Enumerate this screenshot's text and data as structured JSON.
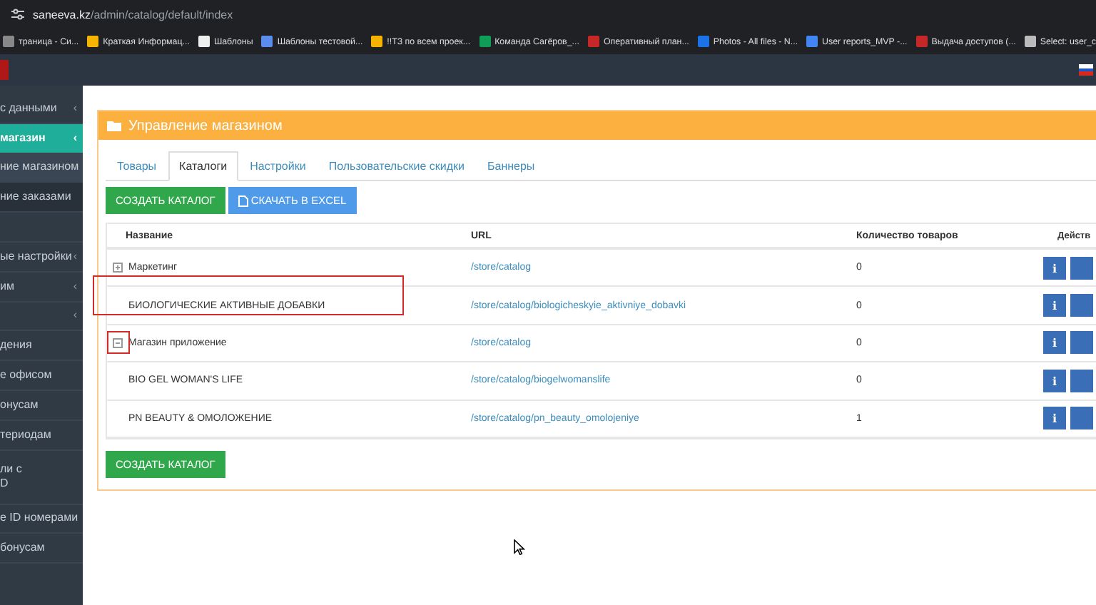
{
  "browser": {
    "url_host": "saneeva.kz",
    "url_path": "/admin/catalog/default/index",
    "bookmarks": [
      {
        "label": "траница - Си...",
        "kind": "page"
      },
      {
        "label": "Краткая Информац...",
        "kind": "drive"
      },
      {
        "label": "Шаблоны",
        "kind": "notion"
      },
      {
        "label": "Шаблоны тестовой...",
        "kind": "yandex"
      },
      {
        "label": "!!ТЗ по всем проек...",
        "kind": "drive"
      },
      {
        "label": "Команда Сагёров_...",
        "kind": "sheet"
      },
      {
        "label": "Оперативный план...",
        "kind": "ring"
      },
      {
        "label": "Photos - All files - N...",
        "kind": "folder"
      },
      {
        "label": "User reports_MVP -...",
        "kind": "doc"
      },
      {
        "label": "Выдача доступов (...",
        "kind": "ring"
      },
      {
        "label": "Select: user_c",
        "kind": "db"
      }
    ]
  },
  "sidebar": {
    "items": [
      {
        "label": "с данными",
        "chevron": "‹",
        "selected": false,
        "kind": "item"
      },
      {
        "label": "магазин",
        "chevron": "‹",
        "selected": true,
        "kind": "item"
      },
      {
        "label": "ние магазином",
        "selected": true,
        "kind": "subitem"
      },
      {
        "label": "ние заказами",
        "selected": false,
        "kind": "subitem"
      },
      {
        "selected": false,
        "kind": "item"
      },
      {
        "label": "ые настройки",
        "chevron": "‹",
        "selected": false,
        "kind": "item"
      },
      {
        "label": "им",
        "chevron": "‹",
        "selected": false,
        "kind": "item"
      },
      {
        "chevron": "‹",
        "selected": false,
        "kind": "item"
      },
      {
        "label": "дения",
        "selected": false,
        "kind": "item"
      },
      {
        "label": "е офисом",
        "selected": false,
        "kind": "item"
      },
      {
        "label": "онусам",
        "selected": false,
        "kind": "item"
      },
      {
        "label": "териодам",
        "selected": false,
        "kind": "item"
      },
      {
        "label": "ли с\nD",
        "selected": false,
        "kind": "item"
      },
      {
        "label": "е ID номерами",
        "selected": false,
        "kind": "item"
      },
      {
        "label": "бонусам",
        "selected": false,
        "kind": "item"
      }
    ]
  },
  "panel": {
    "title": "Управление магазином",
    "tabs": [
      {
        "label": "Товары",
        "selected": false
      },
      {
        "label": "Каталоги",
        "selected": true
      },
      {
        "label": "Настройки",
        "selected": false
      },
      {
        "label": "Пользовательские скидки",
        "selected": false
      },
      {
        "label": "Баннеры",
        "selected": false
      }
    ],
    "buttons": [
      {
        "label": "СОЗДАТЬ КАТАЛОГ",
        "kind": "create"
      },
      {
        "label": "СКАЧАТЬ В EXCEL",
        "kind": "excel"
      }
    ],
    "table": {
      "columns": [
        "Название",
        "URL",
        "Количество товаров",
        "Действ"
      ],
      "rows": [
        {
          "name": "Маркетинг",
          "url": "/store/catalog",
          "count": "0",
          "action": "i",
          "expanded": false
        },
        {
          "name": "БИОЛОГИЧЕСКИЕ АКТИВНЫЕ ДОБАВКИ",
          "url": "/store/catalog/biologicheskyie_aktivniye_dobavki",
          "count": "0",
          "action": "i",
          "marked": true
        },
        {
          "name": "Магазин приложение",
          "url": "/store/catalog",
          "count": "0",
          "action": "i",
          "expanded": true,
          "marked": true,
          "children": [
            {
              "name": "BIO GEL WOMAN'S LIFE",
              "url": "/store/catalog/biogelwomanslife",
              "count": "0",
              "action": "i"
            },
            {
              "name": "PN BEAUTY & ОМОЛОЖЕНИЕ",
              "url": "/store/catalog/pn_beauty_omolojeniye",
              "count": "1",
              "action": "i"
            }
          ]
        }
      ]
    },
    "footer_button": "СОЗДАТЬ КАТАЛОГ"
  }
}
